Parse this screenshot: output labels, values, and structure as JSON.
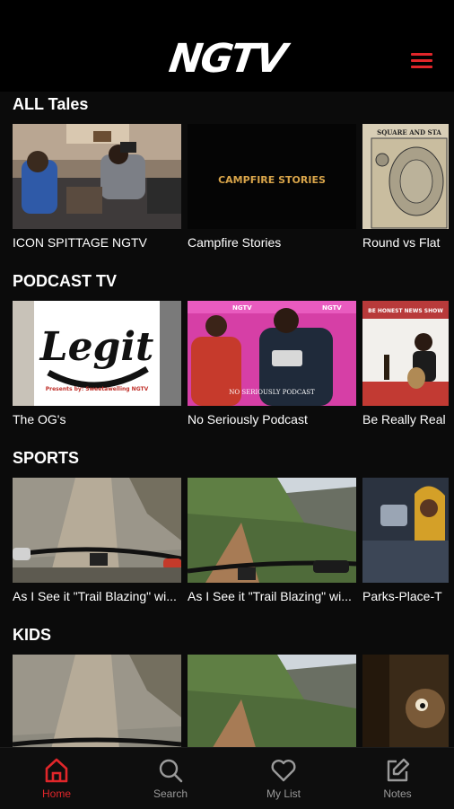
{
  "app": {
    "logo": "NGTV",
    "accent": "#e0262a"
  },
  "header": {
    "menu_icon": "hamburger-menu-icon"
  },
  "sections": [
    {
      "title": "ALL Tales",
      "items": [
        "ICON SPITTAGE NGTV",
        "Campfire Stories",
        "Round vs Flat"
      ]
    },
    {
      "title": "PODCAST TV",
      "items": [
        "The OG's",
        "No Seriously Podcast",
        "Be Really Real"
      ]
    },
    {
      "title": "SPORTS",
      "items": [
        "As I See it \"Trail Blazing\" wi...",
        "As I See it \"Trail Blazing\" wi...",
        "Parks-Place-T"
      ]
    },
    {
      "title": "KIDS",
      "items": [
        "",
        "",
        ""
      ]
    }
  ],
  "thumb_text": {
    "campfire": "CAMPFIRE STORIES",
    "legit": "Legit",
    "legit_sub": "Presents by: Sweetawelling NGTV",
    "no_seriously": "NO SERIOUSLY PODCAST",
    "ngtv_badge": "NGTV",
    "honest_show": "BE HONEST NEWS SHOW",
    "square": "SQUARE AND STA"
  },
  "nav": {
    "home": "Home",
    "search": "Search",
    "mylist": "My List",
    "notes": "Notes"
  }
}
